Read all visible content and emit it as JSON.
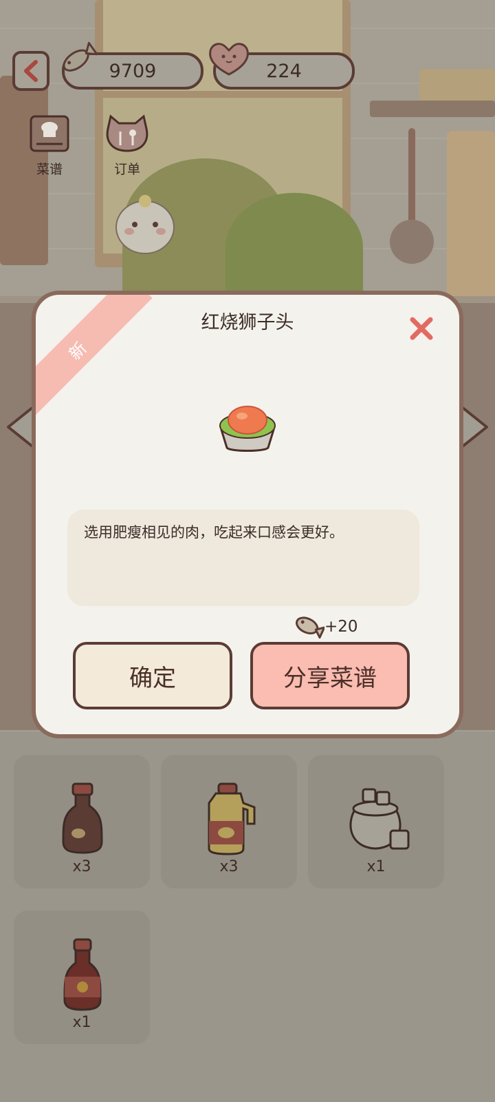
{
  "hud": {
    "fish_count": "9709",
    "heart_count": "224",
    "fish_icon": "fish-icon",
    "heart_icon": "heart-icon"
  },
  "side_buttons": [
    {
      "label": "菜谱",
      "icon": "recipe-book-icon"
    },
    {
      "label": "订单",
      "icon": "order-icon"
    }
  ],
  "dialog": {
    "badge": "新",
    "title": "红烧狮子头",
    "description": "选用肥瘦相见的肉，吃起来口感会更好。",
    "reward": "+20",
    "confirm_label": "确定",
    "share_label": "分享菜谱",
    "dish_icon": "braised-meatball-dish-icon",
    "close_icon": "close-icon"
  },
  "ingredients": [
    {
      "name": "soy-sauce-icon",
      "qty": "x3"
    },
    {
      "name": "cooking-oil-icon",
      "qty": "x3"
    },
    {
      "name": "sugar-jar-icon",
      "qty": "x1"
    },
    {
      "name": "vinegar-bottle-icon",
      "qty": "x1"
    }
  ],
  "colors": {
    "accent_pink": "#fbbcb1",
    "outline_brown": "#5a3c35",
    "close_red": "#e36a62",
    "dialog_bg": "#f4f2ec",
    "overlay_tint": "#9a968c"
  }
}
